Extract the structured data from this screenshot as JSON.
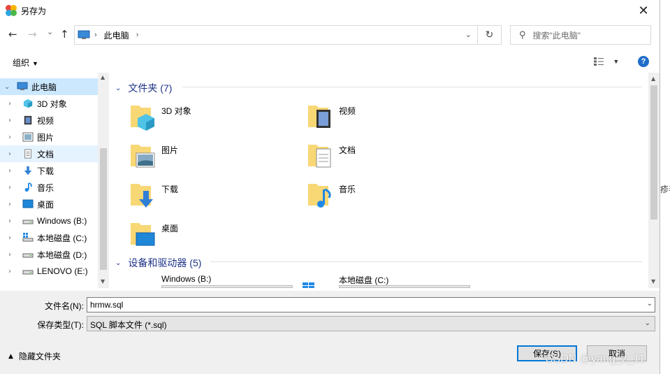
{
  "window": {
    "title": "另存为",
    "close_glyph": "✕",
    "app_icon_colors": [
      "#e8463c",
      "#f7b500",
      "#2aa7e0",
      "#4cb84a"
    ]
  },
  "nav": {
    "back_glyph": "←",
    "forward_glyph": "→",
    "history_glyph": "⌄",
    "up_glyph": "↑",
    "address_crumb": "此电脑",
    "refresh_glyph": "↻",
    "search_placeholder": "搜索\"此电脑\""
  },
  "toolbar": {
    "organize_label": "组织",
    "help_glyph": "?"
  },
  "sidebar": {
    "items": [
      {
        "label": "此电脑",
        "icon": "computer-icon",
        "root": true,
        "selected": true
      },
      {
        "label": "3D 对象",
        "icon": "3d-objects-icon"
      },
      {
        "label": "视频",
        "icon": "video-icon"
      },
      {
        "label": "图片",
        "icon": "pictures-icon"
      },
      {
        "label": "文档",
        "icon": "documents-icon",
        "hover": true
      },
      {
        "label": "下载",
        "icon": "download-icon"
      },
      {
        "label": "音乐",
        "icon": "music-icon"
      },
      {
        "label": "桌面",
        "icon": "desktop-icon"
      },
      {
        "label": "Windows (B:)",
        "icon": "drive-icon"
      },
      {
        "label": "本地磁盘 (C:)",
        "icon": "windows-drive-icon"
      },
      {
        "label": "本地磁盘 (D:)",
        "icon": "drive-icon"
      },
      {
        "label": "LENOVO (E:)",
        "icon": "drive-icon"
      }
    ]
  },
  "content": {
    "folders_header": "文件夹 (7)",
    "folders": [
      {
        "label": "3D 对象",
        "icon": "3d-objects-icon"
      },
      {
        "label": "视频",
        "icon": "video-icon"
      },
      {
        "label": "图片",
        "icon": "pictures-icon"
      },
      {
        "label": "文档",
        "icon": "documents-icon"
      },
      {
        "label": "下载",
        "icon": "download-icon"
      },
      {
        "label": "音乐",
        "icon": "music-icon"
      },
      {
        "label": "桌面",
        "icon": "desktop-icon"
      }
    ],
    "drives_header": "设备和驱动器 (5)",
    "drives": [
      {
        "label": "Windows (B:)",
        "icon": "drive-icon"
      },
      {
        "label": "本地磁盘 (C:)",
        "icon": "windows-drive-icon"
      }
    ]
  },
  "form": {
    "filename_label": "文件名(N):",
    "filename_value": "hrmw.sql",
    "filetype_label": "保存类型(T):",
    "filetype_value": "SQL 脚本文件 (*.sql)",
    "hide_folders_label": "隐藏文件夹",
    "save_label": "保存(S)",
    "cancel_label": "取消"
  },
  "watermark": "CSDN @yang_z_11",
  "edge_text": "疹毒",
  "colors": {
    "selected_bg": "#cce8ff",
    "hover_bg": "#e5f3ff",
    "header_text": "#1e3287",
    "accent": "#0078d7",
    "folder_yellow": "#f8d775"
  }
}
